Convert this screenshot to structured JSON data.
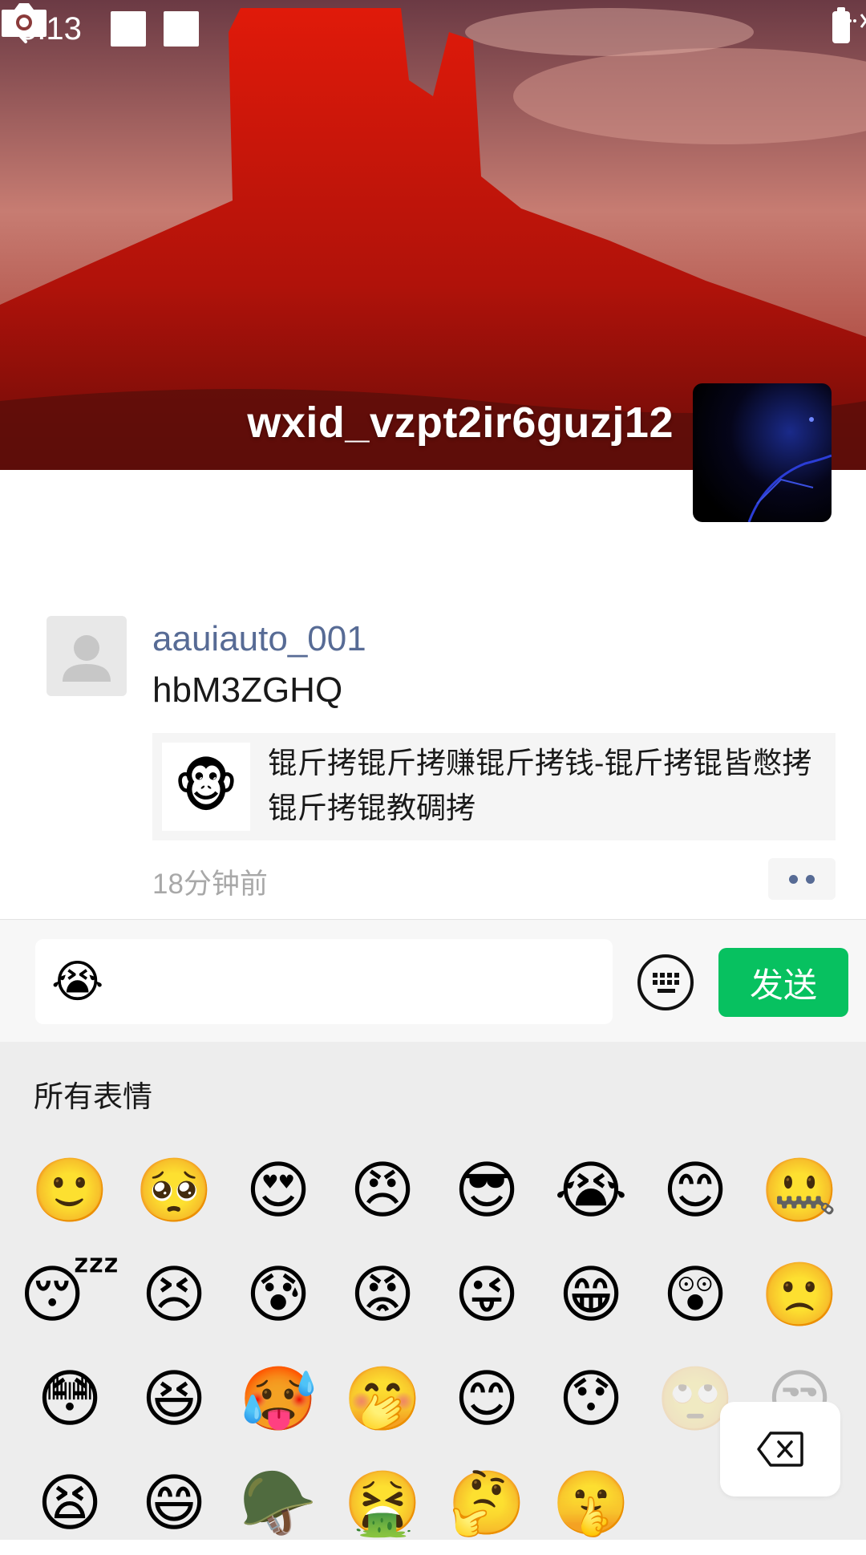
{
  "status_bar": {
    "time": "5:13"
  },
  "profile": {
    "name": "wxid_vzpt2ir6guzj12"
  },
  "post": {
    "username": "aauiauto_001",
    "text": "hbM3ZGHQ",
    "share_title": "锟斤拷锟斤拷赚锟斤拷钱-锟斤拷锟皆憋拷锟斤拷锟教碉拷",
    "time": "18分钟前"
  },
  "comment_input": {
    "value": "😭"
  },
  "send_label": "发送",
  "emoji_panel": {
    "title": "所有表情",
    "emojis": [
      "🙂",
      "🥺",
      "😍",
      "😠",
      "😎",
      "😭",
      "😊",
      "🤐",
      "😴",
      "😣",
      "😰",
      "😡",
      "😜",
      "😁",
      "😲",
      "🙁",
      "😳",
      "😆",
      "🥵",
      "🤭",
      "😊",
      "😯",
      "🙄",
      "😒",
      "😫",
      "😄",
      "🪖",
      "🤮",
      "🤔",
      "🤫"
    ]
  },
  "colors": {
    "accent_green": "#07c160",
    "link_blue": "#576b95"
  }
}
